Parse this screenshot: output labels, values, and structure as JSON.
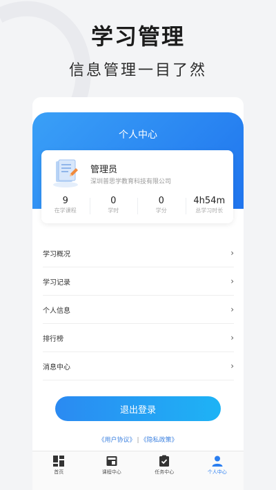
{
  "promo": {
    "title": "学习管理",
    "subtitle": "信息管理一目了然"
  },
  "header": {
    "title": "个人中心"
  },
  "profile": {
    "icon": "document-icon",
    "name": "管理员",
    "company": "深圳普思学教育科技有限公司",
    "stats": [
      {
        "value": "9",
        "label": "在学课程"
      },
      {
        "value": "0",
        "label": "学时"
      },
      {
        "value": "0",
        "label": "学分"
      },
      {
        "value": "4h54m",
        "label": "总学习时长"
      }
    ]
  },
  "menu": {
    "items": [
      {
        "label": "学习概况",
        "icon": "chevron-right-icon"
      },
      {
        "label": "学习记录",
        "icon": "chevron-right-icon"
      },
      {
        "label": "个人信息",
        "icon": "chevron-right-icon"
      },
      {
        "label": "排行榜",
        "icon": "chevron-right-icon"
      },
      {
        "label": "消息中心",
        "icon": "chevron-right-icon"
      }
    ]
  },
  "logout": {
    "label": "退出登录"
  },
  "agreements": {
    "user_agreement": "《用户协议》",
    "separator": "|",
    "privacy_policy": "《隐私政策》"
  },
  "tabbar": {
    "items": [
      {
        "label": "首页",
        "icon": "home-grid-icon",
        "active": false
      },
      {
        "label": "课程中心",
        "icon": "course-icon",
        "active": false
      },
      {
        "label": "任务中心",
        "icon": "task-check-icon",
        "active": false
      },
      {
        "label": "个人中心",
        "icon": "person-icon",
        "active": true
      }
    ]
  },
  "colors": {
    "accent": "#1f74ee",
    "header_gradient_start": "#3aa0f7",
    "button_gradient_end": "#1eb3f5",
    "link": "#3d82e0"
  }
}
